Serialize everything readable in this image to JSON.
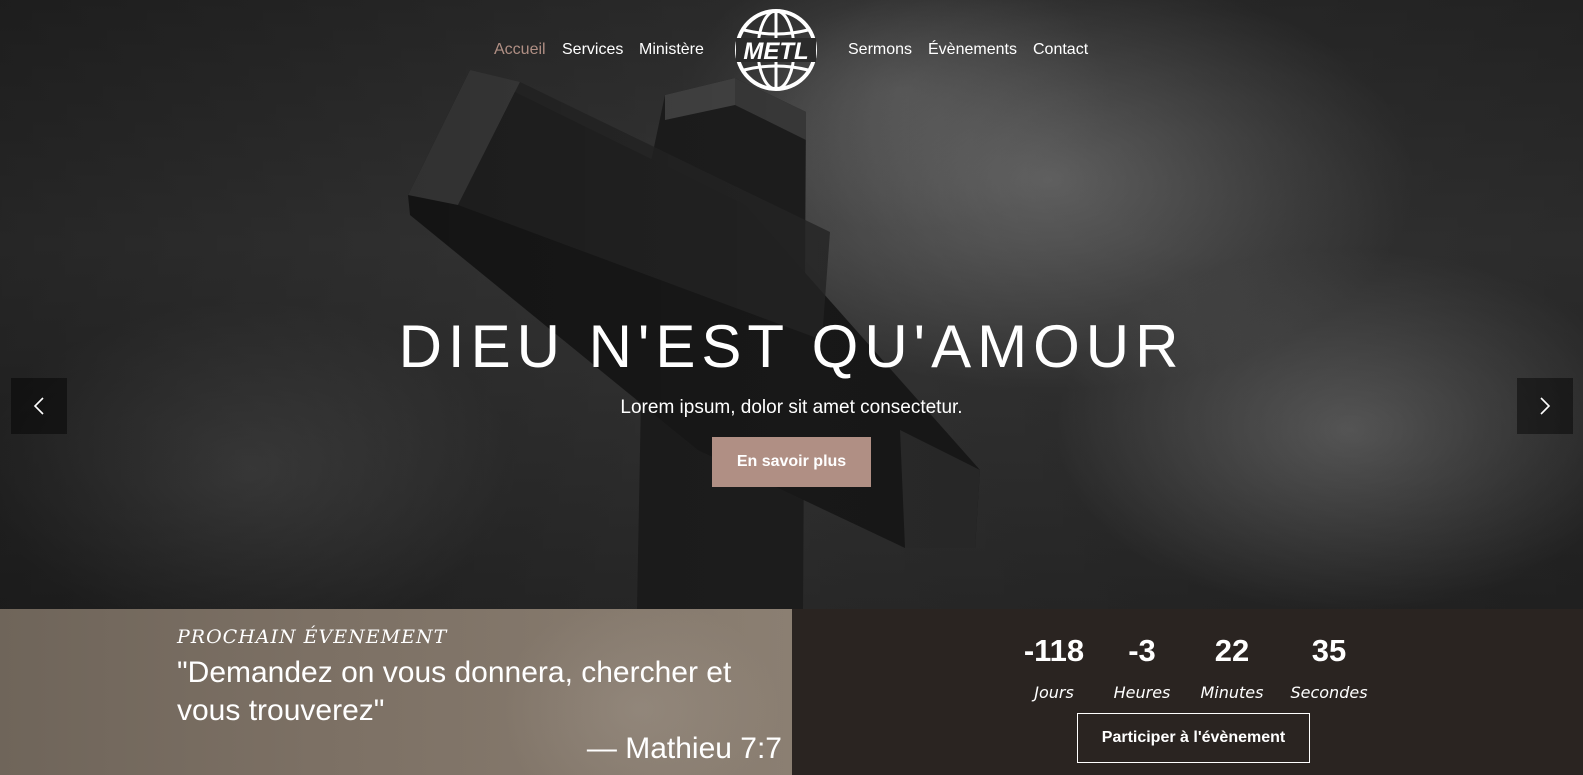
{
  "nav": {
    "left_items": [
      {
        "label": "Accueil",
        "active": true
      },
      {
        "label": "Services",
        "active": false
      },
      {
        "label": "Ministère",
        "active": false
      }
    ],
    "right_items": [
      {
        "label": "Sermons",
        "active": false
      },
      {
        "label": "Évènements",
        "active": false
      },
      {
        "label": "Contact",
        "active": false
      }
    ],
    "logo_text": "METL",
    "active_color": "#b08f84"
  },
  "hero": {
    "title": "DIEU N'EST QU'AMOUR",
    "subtitle": "Lorem ipsum, dolor sit amet consectetur.",
    "cta_label": "En savoir plus",
    "cta_color": "#b08f84",
    "prev_icon": "chevron-left-icon",
    "next_icon": "chevron-right-icon"
  },
  "event": {
    "label": "PROCHAIN ÉVENEMENT",
    "quote": "\"Demandez on vous donnera, chercher et vous trouverez\"",
    "reference": "— Mathieu 7:7",
    "countdown": [
      {
        "value": "-118",
        "unit": "Jours"
      },
      {
        "value": "-3",
        "unit": "Heures"
      },
      {
        "value": "22",
        "unit": "Minutes"
      },
      {
        "value": "35",
        "unit": "Secondes"
      }
    ],
    "join_label": "Participer à l'évènement"
  }
}
